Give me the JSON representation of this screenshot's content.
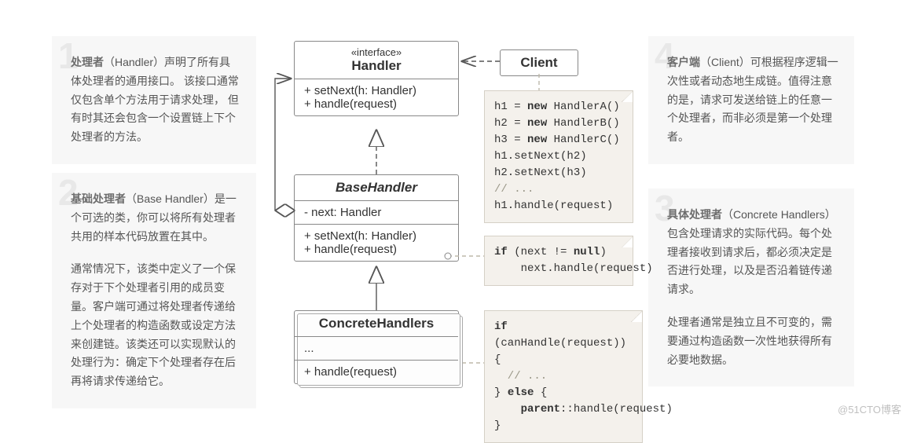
{
  "watermark": "@51CTO博客",
  "notes": {
    "n1": {
      "num": "1",
      "title": "处理者",
      "paren": "（Handler）",
      "text": "声明了所有具体处理者的通用接口。 该接口通常仅包含单个方法用于请求处理， 但有时其还会包含一个设置链上下个处理者的方法。"
    },
    "n2": {
      "num": "2",
      "title": "基础处理者",
      "paren": "（Base Handler）",
      "text1": "是一个可选的类，你可以将所有处理者共用的样本代码放置在其中。",
      "text2": "通常情况下，该类中定义了一个保存对于下个处理者引用的成员变量。客户端可通过将处理者传递给上个处理者的构造函数或设定方法来创建链。该类还可以实现默认的处理行为：确定下个处理者存在后再将请求传递给它。"
    },
    "n3": {
      "num": "3",
      "title": "具体处理者",
      "paren": "（Concrete Handlers）",
      "text1": "包含处理请求的实际代码。每个处理者接收到请求后，都必须决定是否进行处理，以及是否沿着链传递请求。",
      "text2": "处理者通常是独立且不可变的，需要通过构造函数一次性地获得所有必要地数据。"
    },
    "n4": {
      "num": "4",
      "title": "客户端",
      "paren": "（Client）",
      "text": "可根据程序逻辑一次性或者动态地生成链。值得注意的是，请求可发送给链上的任意一个处理者，而非必须是第一个处理者。"
    }
  },
  "uml": {
    "handler": {
      "stereotype": "«interface»",
      "name": "Handler",
      "ops": [
        "+ setNext(h: Handler)",
        "+ handle(request)"
      ]
    },
    "base": {
      "name": "BaseHandler",
      "attrs": [
        "- next: Handler"
      ],
      "ops": [
        "+ setNext(h: Handler)",
        "+ handle(request)"
      ]
    },
    "concrete": {
      "name": "ConcreteHandlers",
      "attrs": [
        "..."
      ],
      "ops": [
        "+ handle(request)"
      ]
    },
    "client": {
      "name": "Client"
    }
  },
  "code": {
    "client": {
      "l1a": "h1 = ",
      "l1b": "new",
      "l1c": " HandlerA()",
      "l2a": "h2 = ",
      "l2b": "new",
      "l2c": " HandlerB()",
      "l3a": "h3 = ",
      "l3b": "new",
      "l3c": " HandlerC()",
      "l4": "h1.setNext(h2)",
      "l5": "h2.setNext(h3)",
      "l6": "// ...",
      "l7": "h1.handle(request)"
    },
    "base": {
      "l1a": "if",
      "l1b": " (next != ",
      "l1c": "null",
      "l1d": ")",
      "l2": "    next.handle(request)"
    },
    "concrete": {
      "l1a": "if",
      "l1b": " (canHandle(request)) {",
      "l2": "  // ...",
      "l3a": "} ",
      "l3b": "else",
      "l3c": " {",
      "l4a": "    ",
      "l4b": "parent",
      "l4c": "::handle(request)",
      "l5": "}"
    }
  }
}
